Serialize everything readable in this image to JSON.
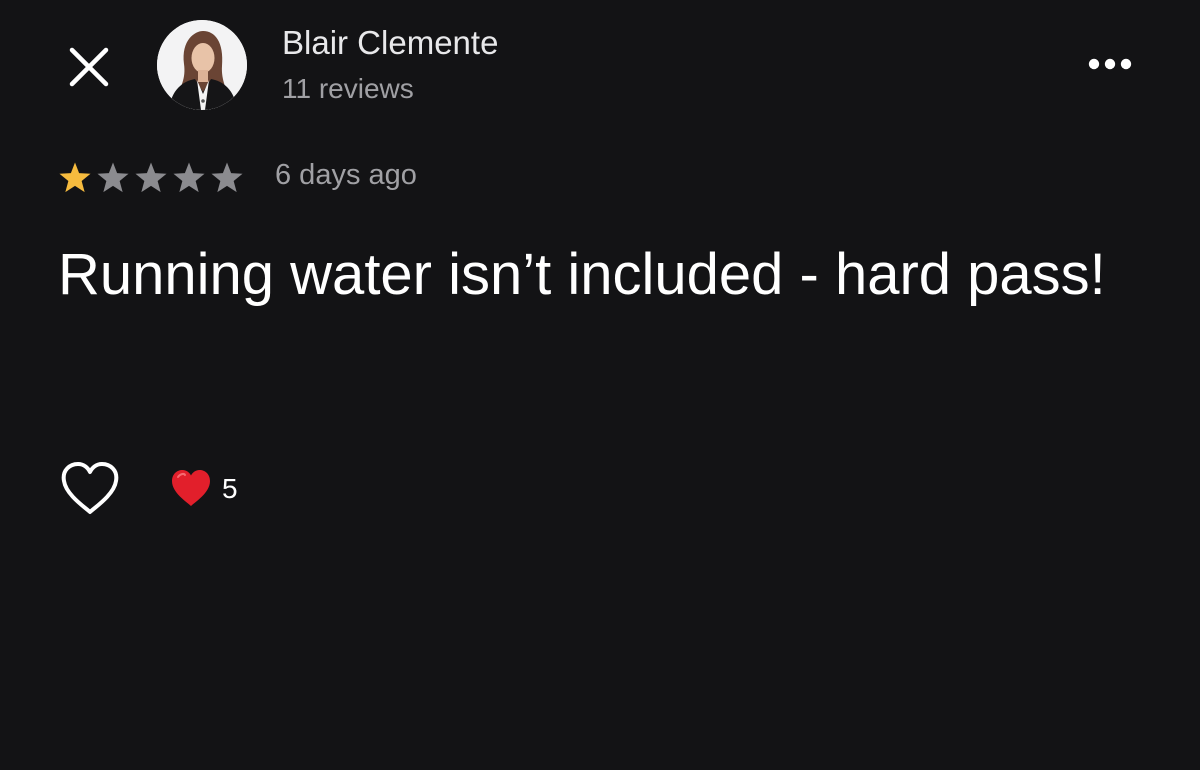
{
  "header": {
    "close_icon": "close-icon",
    "reviewer": {
      "name": "Blair Clemente",
      "reviews": "11 reviews"
    },
    "more_icon": "more-horizontal-icon"
  },
  "review": {
    "rating": 1,
    "max_rating": 5,
    "star_color_filled": "#f6bb3e",
    "star_color_empty": "#8b8b8f",
    "date": "6 days ago",
    "text": "Running water isn’t included - hard pass!"
  },
  "reactions": {
    "like_icon": "heart-outline-icon",
    "reaction_icon": "red-heart-icon",
    "reaction_color": "#e21f2b",
    "count": "5"
  }
}
